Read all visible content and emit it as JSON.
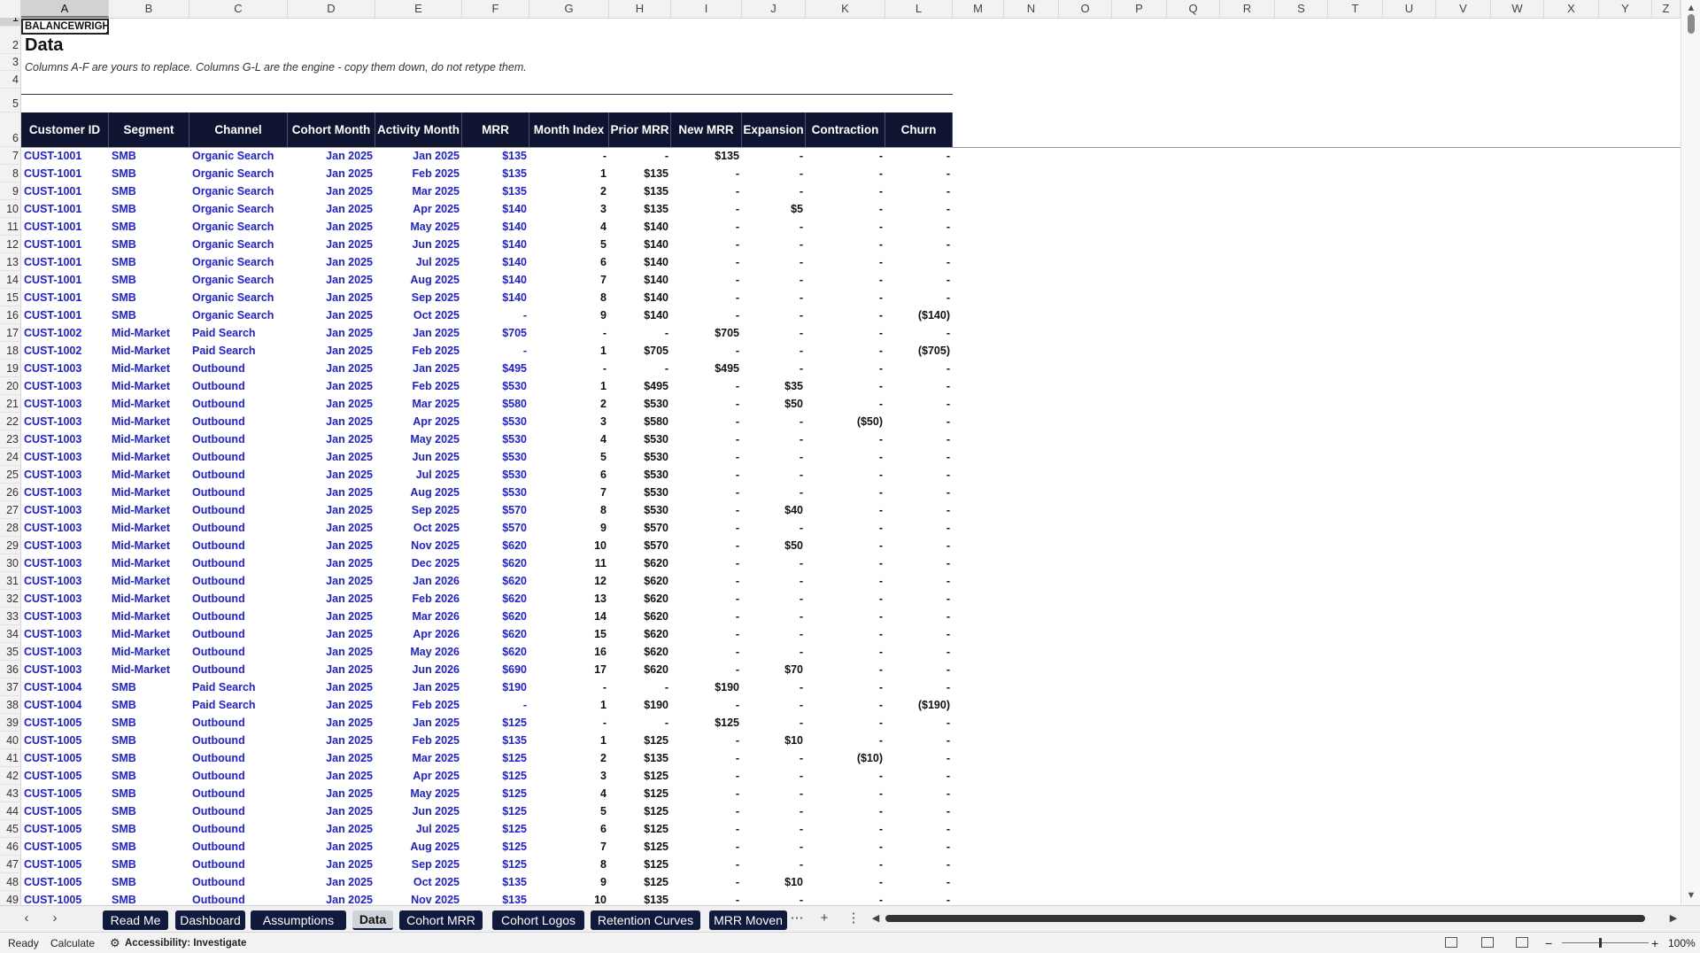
{
  "sheet": {
    "brand_cell": "BALANCEWRIGHT",
    "title": "Data",
    "note": "Columns A-F are yours to replace. Columns G-L are the engine - copy them down, do not retype them.",
    "selected_column": "A",
    "selected_row": "1"
  },
  "columns": [
    {
      "letter": "A",
      "header": "Customer ID"
    },
    {
      "letter": "B",
      "header": "Segment"
    },
    {
      "letter": "C",
      "header": "Channel"
    },
    {
      "letter": "D",
      "header": "Cohort Month"
    },
    {
      "letter": "E",
      "header": "Activity Month"
    },
    {
      "letter": "F",
      "header": "MRR"
    },
    {
      "letter": "G",
      "header": "Month Index"
    },
    {
      "letter": "H",
      "header": "Prior MRR"
    },
    {
      "letter": "I",
      "header": "New MRR"
    },
    {
      "letter": "J",
      "header": "Expansion"
    },
    {
      "letter": "K",
      "header": "Contraction"
    },
    {
      "letter": "L",
      "header": "Churn"
    },
    {
      "letter": "M",
      "header": ""
    },
    {
      "letter": "N",
      "header": ""
    },
    {
      "letter": "O",
      "header": ""
    },
    {
      "letter": "P",
      "header": ""
    },
    {
      "letter": "Q",
      "header": ""
    },
    {
      "letter": "R",
      "header": ""
    },
    {
      "letter": "S",
      "header": ""
    },
    {
      "letter": "T",
      "header": ""
    },
    {
      "letter": "U",
      "header": ""
    },
    {
      "letter": "V",
      "header": ""
    },
    {
      "letter": "W",
      "header": ""
    },
    {
      "letter": "X",
      "header": ""
    },
    {
      "letter": "Y",
      "header": ""
    },
    {
      "letter": "Z",
      "header": ""
    }
  ],
  "rows": [
    [
      "7",
      "CUST-1001",
      "SMB",
      "Organic Search",
      "Jan 2025",
      "Jan 2025",
      "$135",
      "-",
      "-",
      "$135",
      "-",
      "-",
      "-"
    ],
    [
      "8",
      "CUST-1001",
      "SMB",
      "Organic Search",
      "Jan 2025",
      "Feb 2025",
      "$135",
      "1",
      "$135",
      "-",
      "-",
      "-",
      "-"
    ],
    [
      "9",
      "CUST-1001",
      "SMB",
      "Organic Search",
      "Jan 2025",
      "Mar 2025",
      "$135",
      "2",
      "$135",
      "-",
      "-",
      "-",
      "-"
    ],
    [
      "10",
      "CUST-1001",
      "SMB",
      "Organic Search",
      "Jan 2025",
      "Apr 2025",
      "$140",
      "3",
      "$135",
      "-",
      "$5",
      "-",
      "-"
    ],
    [
      "11",
      "CUST-1001",
      "SMB",
      "Organic Search",
      "Jan 2025",
      "May 2025",
      "$140",
      "4",
      "$140",
      "-",
      "-",
      "-",
      "-"
    ],
    [
      "12",
      "CUST-1001",
      "SMB",
      "Organic Search",
      "Jan 2025",
      "Jun 2025",
      "$140",
      "5",
      "$140",
      "-",
      "-",
      "-",
      "-"
    ],
    [
      "13",
      "CUST-1001",
      "SMB",
      "Organic Search",
      "Jan 2025",
      "Jul 2025",
      "$140",
      "6",
      "$140",
      "-",
      "-",
      "-",
      "-"
    ],
    [
      "14",
      "CUST-1001",
      "SMB",
      "Organic Search",
      "Jan 2025",
      "Aug 2025",
      "$140",
      "7",
      "$140",
      "-",
      "-",
      "-",
      "-"
    ],
    [
      "15",
      "CUST-1001",
      "SMB",
      "Organic Search",
      "Jan 2025",
      "Sep 2025",
      "$140",
      "8",
      "$140",
      "-",
      "-",
      "-",
      "-"
    ],
    [
      "16",
      "CUST-1001",
      "SMB",
      "Organic Search",
      "Jan 2025",
      "Oct 2025",
      "-",
      "9",
      "$140",
      "-",
      "-",
      "-",
      "($140)"
    ],
    [
      "17",
      "CUST-1002",
      "Mid-Market",
      "Paid Search",
      "Jan 2025",
      "Jan 2025",
      "$705",
      "-",
      "-",
      "$705",
      "-",
      "-",
      "-"
    ],
    [
      "18",
      "CUST-1002",
      "Mid-Market",
      "Paid Search",
      "Jan 2025",
      "Feb 2025",
      "-",
      "1",
      "$705",
      "-",
      "-",
      "-",
      "($705)"
    ],
    [
      "19",
      "CUST-1003",
      "Mid-Market",
      "Outbound",
      "Jan 2025",
      "Jan 2025",
      "$495",
      "-",
      "-",
      "$495",
      "-",
      "-",
      "-"
    ],
    [
      "20",
      "CUST-1003",
      "Mid-Market",
      "Outbound",
      "Jan 2025",
      "Feb 2025",
      "$530",
      "1",
      "$495",
      "-",
      "$35",
      "-",
      "-"
    ],
    [
      "21",
      "CUST-1003",
      "Mid-Market",
      "Outbound",
      "Jan 2025",
      "Mar 2025",
      "$580",
      "2",
      "$530",
      "-",
      "$50",
      "-",
      "-"
    ],
    [
      "22",
      "CUST-1003",
      "Mid-Market",
      "Outbound",
      "Jan 2025",
      "Apr 2025",
      "$530",
      "3",
      "$580",
      "-",
      "-",
      "($50)",
      "-"
    ],
    [
      "23",
      "CUST-1003",
      "Mid-Market",
      "Outbound",
      "Jan 2025",
      "May 2025",
      "$530",
      "4",
      "$530",
      "-",
      "-",
      "-",
      "-"
    ],
    [
      "24",
      "CUST-1003",
      "Mid-Market",
      "Outbound",
      "Jan 2025",
      "Jun 2025",
      "$530",
      "5",
      "$530",
      "-",
      "-",
      "-",
      "-"
    ],
    [
      "25",
      "CUST-1003",
      "Mid-Market",
      "Outbound",
      "Jan 2025",
      "Jul 2025",
      "$530",
      "6",
      "$530",
      "-",
      "-",
      "-",
      "-"
    ],
    [
      "26",
      "CUST-1003",
      "Mid-Market",
      "Outbound",
      "Jan 2025",
      "Aug 2025",
      "$530",
      "7",
      "$530",
      "-",
      "-",
      "-",
      "-"
    ],
    [
      "27",
      "CUST-1003",
      "Mid-Market",
      "Outbound",
      "Jan 2025",
      "Sep 2025",
      "$570",
      "8",
      "$530",
      "-",
      "$40",
      "-",
      "-"
    ],
    [
      "28",
      "CUST-1003",
      "Mid-Market",
      "Outbound",
      "Jan 2025",
      "Oct 2025",
      "$570",
      "9",
      "$570",
      "-",
      "-",
      "-",
      "-"
    ],
    [
      "29",
      "CUST-1003",
      "Mid-Market",
      "Outbound",
      "Jan 2025",
      "Nov 2025",
      "$620",
      "10",
      "$570",
      "-",
      "$50",
      "-",
      "-"
    ],
    [
      "30",
      "CUST-1003",
      "Mid-Market",
      "Outbound",
      "Jan 2025",
      "Dec 2025",
      "$620",
      "11",
      "$620",
      "-",
      "-",
      "-",
      "-"
    ],
    [
      "31",
      "CUST-1003",
      "Mid-Market",
      "Outbound",
      "Jan 2025",
      "Jan 2026",
      "$620",
      "12",
      "$620",
      "-",
      "-",
      "-",
      "-"
    ],
    [
      "32",
      "CUST-1003",
      "Mid-Market",
      "Outbound",
      "Jan 2025",
      "Feb 2026",
      "$620",
      "13",
      "$620",
      "-",
      "-",
      "-",
      "-"
    ],
    [
      "33",
      "CUST-1003",
      "Mid-Market",
      "Outbound",
      "Jan 2025",
      "Mar 2026",
      "$620",
      "14",
      "$620",
      "-",
      "-",
      "-",
      "-"
    ],
    [
      "34",
      "CUST-1003",
      "Mid-Market",
      "Outbound",
      "Jan 2025",
      "Apr 2026",
      "$620",
      "15",
      "$620",
      "-",
      "-",
      "-",
      "-"
    ],
    [
      "35",
      "CUST-1003",
      "Mid-Market",
      "Outbound",
      "Jan 2025",
      "May 2026",
      "$620",
      "16",
      "$620",
      "-",
      "-",
      "-",
      "-"
    ],
    [
      "36",
      "CUST-1003",
      "Mid-Market",
      "Outbound",
      "Jan 2025",
      "Jun 2026",
      "$690",
      "17",
      "$620",
      "-",
      "$70",
      "-",
      "-"
    ],
    [
      "37",
      "CUST-1004",
      "SMB",
      "Paid Search",
      "Jan 2025",
      "Jan 2025",
      "$190",
      "-",
      "-",
      "$190",
      "-",
      "-",
      "-"
    ],
    [
      "38",
      "CUST-1004",
      "SMB",
      "Paid Search",
      "Jan 2025",
      "Feb 2025",
      "-",
      "1",
      "$190",
      "-",
      "-",
      "-",
      "($190)"
    ],
    [
      "39",
      "CUST-1005",
      "SMB",
      "Outbound",
      "Jan 2025",
      "Jan 2025",
      "$125",
      "-",
      "-",
      "$125",
      "-",
      "-",
      "-"
    ],
    [
      "40",
      "CUST-1005",
      "SMB",
      "Outbound",
      "Jan 2025",
      "Feb 2025",
      "$135",
      "1",
      "$125",
      "-",
      "$10",
      "-",
      "-"
    ],
    [
      "41",
      "CUST-1005",
      "SMB",
      "Outbound",
      "Jan 2025",
      "Mar 2025",
      "$125",
      "2",
      "$135",
      "-",
      "-",
      "($10)",
      "-"
    ],
    [
      "42",
      "CUST-1005",
      "SMB",
      "Outbound",
      "Jan 2025",
      "Apr 2025",
      "$125",
      "3",
      "$125",
      "-",
      "-",
      "-",
      "-"
    ],
    [
      "43",
      "CUST-1005",
      "SMB",
      "Outbound",
      "Jan 2025",
      "May 2025",
      "$125",
      "4",
      "$125",
      "-",
      "-",
      "-",
      "-"
    ],
    [
      "44",
      "CUST-1005",
      "SMB",
      "Outbound",
      "Jan 2025",
      "Jun 2025",
      "$125",
      "5",
      "$125",
      "-",
      "-",
      "-",
      "-"
    ],
    [
      "45",
      "CUST-1005",
      "SMB",
      "Outbound",
      "Jan 2025",
      "Jul 2025",
      "$125",
      "6",
      "$125",
      "-",
      "-",
      "-",
      "-"
    ],
    [
      "46",
      "CUST-1005",
      "SMB",
      "Outbound",
      "Jan 2025",
      "Aug 2025",
      "$125",
      "7",
      "$125",
      "-",
      "-",
      "-",
      "-"
    ],
    [
      "47",
      "CUST-1005",
      "SMB",
      "Outbound",
      "Jan 2025",
      "Sep 2025",
      "$125",
      "8",
      "$125",
      "-",
      "-",
      "-",
      "-"
    ],
    [
      "48",
      "CUST-1005",
      "SMB",
      "Outbound",
      "Jan 2025",
      "Oct 2025",
      "$135",
      "9",
      "$125",
      "-",
      "$10",
      "-",
      "-"
    ],
    [
      "49",
      "CUST-1005",
      "SMB",
      "Outbound",
      "Jan 2025",
      "Nov 2025",
      "$135",
      "10",
      "$135",
      "-",
      "-",
      "-",
      "-"
    ]
  ],
  "tabs": [
    {
      "label": "Read Me",
      "active": false
    },
    {
      "label": "Dashboard",
      "active": false
    },
    {
      "label": "Assumptions",
      "active": false
    },
    {
      "label": "Data",
      "active": true
    },
    {
      "label": "Cohort MRR",
      "active": false
    },
    {
      "label": "Cohort Logos",
      "active": false
    },
    {
      "label": "Retention Curves",
      "active": false
    },
    {
      "label": "MRR Moven",
      "active": false
    }
  ],
  "tabbar": {
    "prev_icon": "chevron-left-icon",
    "next_icon": "chevron-right-icon",
    "more_icon": "ellipsis-icon",
    "add_icon": "plus-icon",
    "options_icon": "vertical-dots-icon"
  },
  "status": {
    "ready": "Ready",
    "calculate": "Calculate",
    "accessibility": "Accessibility: Investigate",
    "zoom": "100%"
  },
  "colors": {
    "header_bg": "#0f1530",
    "input_text": "#1f1fd8",
    "tab_bg": "#0f1a3c"
  }
}
